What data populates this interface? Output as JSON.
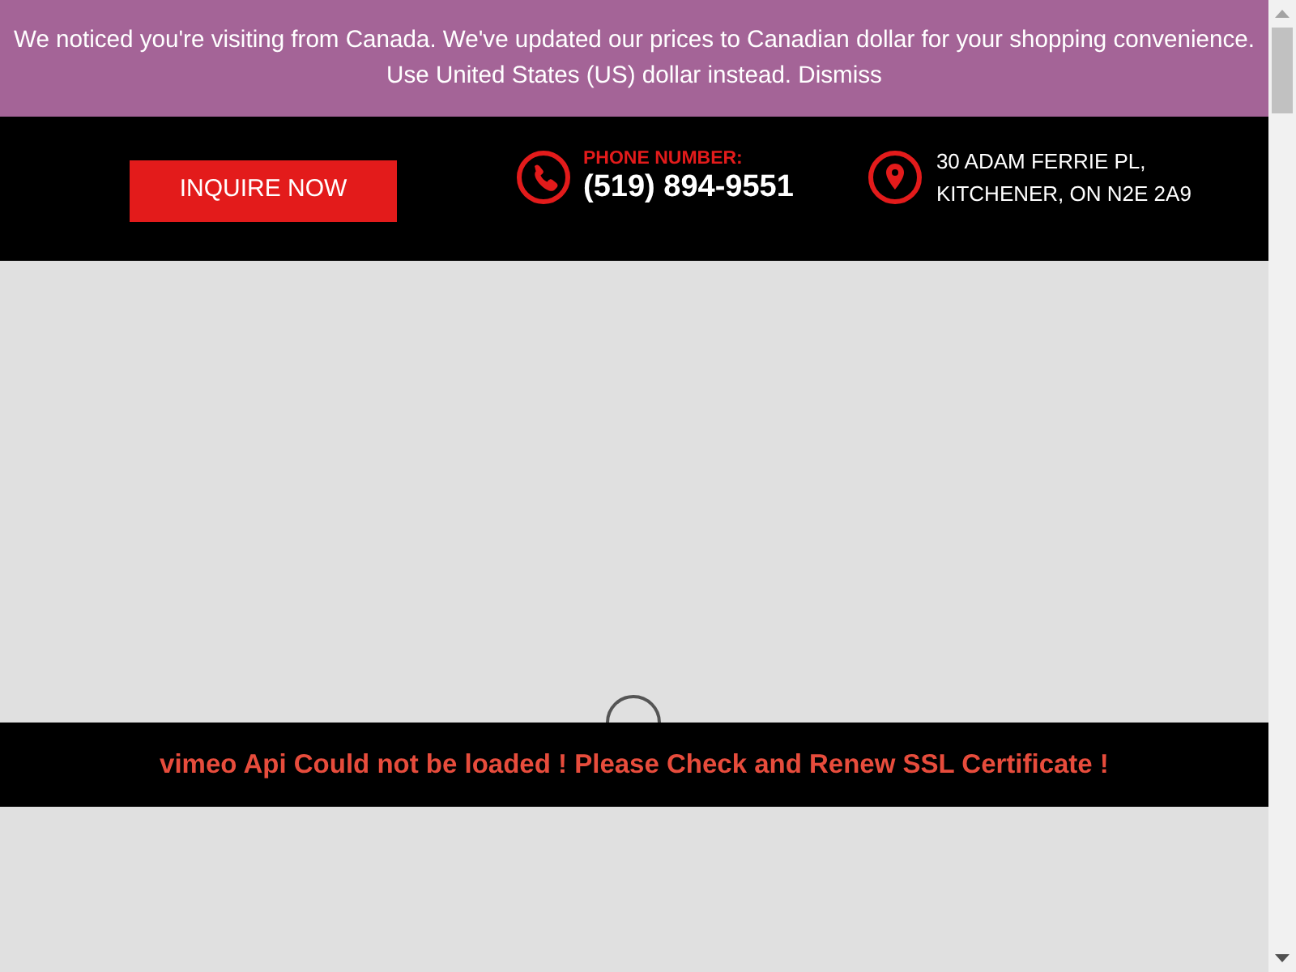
{
  "notice": {
    "message": "We noticed you're visiting from Canada. We've updated our prices to Canadian dollar for your shopping convenience.",
    "currency_link": "Use United States (US) dollar instead.",
    "dismiss_link": "Dismiss"
  },
  "header": {
    "button": "INQUIRE NOW",
    "phone": {
      "label": "PHONE NUMBER:",
      "number": "(519) 894-9551"
    },
    "address": {
      "lines": [
        "30 ADAM FERRIE PL,",
        "KITCHENER, ON N2E 2A9"
      ]
    }
  },
  "video_error": {
    "message": "vimeo Api Could not be loaded ! Please Check and Renew SSL Certificate !"
  }
}
